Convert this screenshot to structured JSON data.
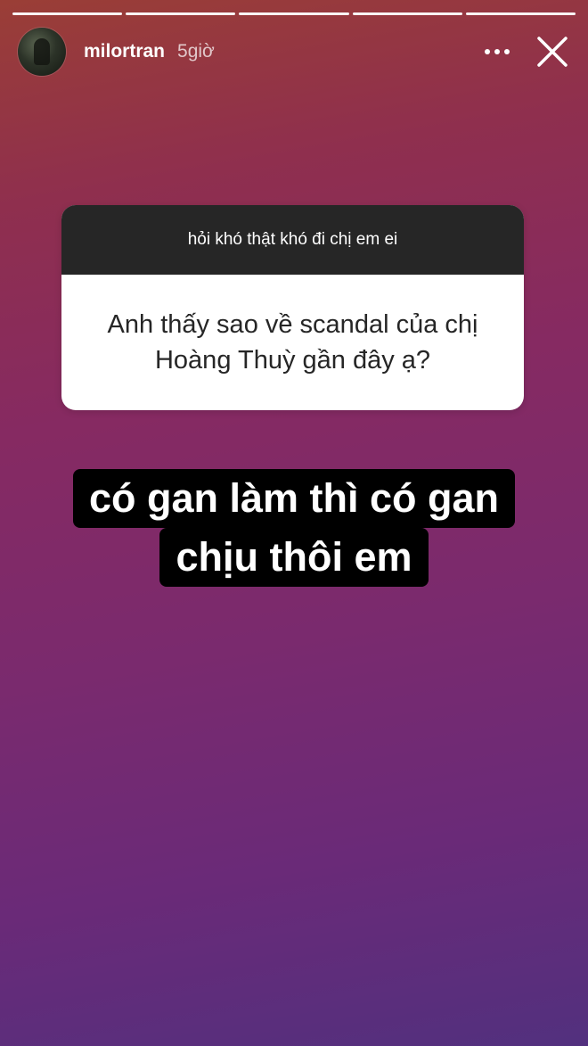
{
  "story": {
    "progress_segments": 5,
    "progress_done": 5
  },
  "header": {
    "username": "milortran",
    "time": "5giờ",
    "avatar_icon": "user-avatar-photo",
    "more_icon": "more-dots-icon",
    "close_icon": "close-icon"
  },
  "question_card": {
    "prompt": "hỏi khó thật khó đi chị em ei",
    "question": "Anh thấy sao về scandal của chị Hoàng Thuỳ gần đây ạ?"
  },
  "answer": {
    "line1": "có gan làm thì có gan",
    "line2": "chịu thôi em"
  },
  "colors": {
    "card_header_bg": "#262626",
    "card_body_bg": "#ffffff",
    "answer_bg": "#000000"
  }
}
